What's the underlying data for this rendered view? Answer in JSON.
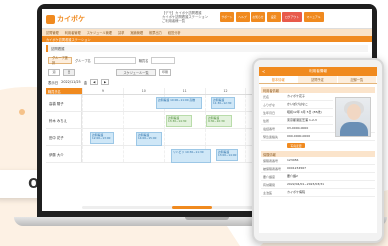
{
  "colors": {
    "accent": "#f08a1f",
    "accent_light": "#fdeedd",
    "appointment_blue": "#cfe7f7",
    "appointment_green": "#e3f2dd"
  },
  "callout": {
    "label": "OT)"
  },
  "laptop": {
    "logo_text": "カイポケ",
    "header_info": [
      "【デモ】カイポケ訪問看護",
      "カイポケ訪問看護ステーション",
      "ご利用者様一覧"
    ],
    "header_buttons": [
      "サポート",
      "ヘルプ",
      "お知らせ",
      "設定",
      "ログアウト",
      "マニュアル"
    ],
    "nav_items": [
      "訪問管理",
      "利用者管理",
      "スケジュール管理",
      "請求",
      "実績管理",
      "帳票出力",
      "経営分析"
    ],
    "sub_title": "カイポケ訪問看護ステーション",
    "panel_title": "訪問看護",
    "filter": {
      "group_label": "グループ選択",
      "group_value": "グループ名",
      "staff_label": "職員名",
      "staff_value": ""
    },
    "toggles": [
      "週",
      "日"
    ],
    "schedule_button": "スケジュール一覧",
    "print_label": "印刷",
    "date_label": "表示日",
    "date_value": "2022/11/25",
    "weekday_label": "金",
    "grid_header_name": "職員氏名",
    "grid_hours": [
      "9",
      "10",
      "11",
      "12",
      "13",
      "14",
      "15"
    ],
    "staff_rows": [
      "高橋 陽子",
      "鈴木 みちえ",
      "田中 花子",
      "伊藤 大介"
    ],
    "appointments": [
      {
        "text": "訪問看護 10:00~11:00 高橋",
        "style": "blue"
      },
      {
        "text": "訪問看護 11:30~12:30",
        "style": "blue"
      },
      {
        "text": "訪問看護 13:30~14:30",
        "style": "green"
      },
      {
        "text": "訪問看護 9:30~10:30",
        "style": "green"
      },
      {
        "text": "訪問看護 12:00~13:00",
        "style": "blue"
      },
      {
        "text": "訪問看護 14:00~15:00",
        "style": "blue"
      },
      {
        "text": "リハビリ 10:30~11:30",
        "style": "blue"
      },
      {
        "text": "訪問看護 13:00~14:00",
        "style": "blue"
      }
    ]
  },
  "tablet": {
    "top_title": "利用者情報",
    "back_label": "<",
    "tabs": [
      "基本情報",
      "訪問予定",
      "記録一覧"
    ],
    "section1": "利用者情報",
    "rows1": [
      {
        "k": "氏名",
        "v": "カイポケ花子"
      },
      {
        "k": "ふりがな",
        "v": "かいぽけはなこ"
      },
      {
        "k": "生年月日",
        "v": "昭和12年 4月 5日 (85歳)"
      },
      {
        "k": "住所",
        "v": "東京都港区芝浦 1-2-3"
      },
      {
        "k": "電話番号",
        "v": "03-0000-0000"
      },
      {
        "k": "緊急連絡先",
        "v": "090-0000-0000"
      }
    ],
    "photo_button": "写真変更",
    "section2": "保険情報",
    "rows2": [
      {
        "k": "保険者番号",
        "v": "123456"
      },
      {
        "k": "被保険者番号",
        "v": "0001234567"
      },
      {
        "k": "要介護度",
        "v": "要介護2"
      },
      {
        "k": "有効期間",
        "v": "2022/04/01~2023/03/31"
      },
      {
        "k": "主治医",
        "v": "カイポケ病院"
      }
    ]
  }
}
